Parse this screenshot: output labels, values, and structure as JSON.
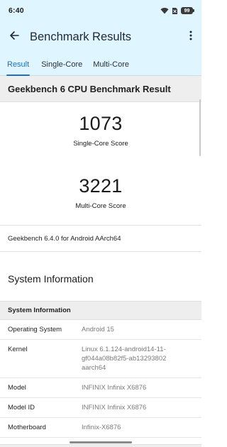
{
  "status_bar": {
    "time": "6:40",
    "battery": "99",
    "icons": [
      "wifi-icon",
      "no-sim-icon",
      "battery-icon"
    ]
  },
  "app_bar": {
    "title": "Benchmark Results",
    "back_icon": "arrow-left-icon",
    "more_icon": "more-vertical-icon"
  },
  "tabs": [
    {
      "label": "Result",
      "selected": true
    },
    {
      "label": "Single-Core",
      "selected": false
    },
    {
      "label": "Multi-Core",
      "selected": false
    }
  ],
  "result_card": {
    "header": "Geekbench 6 CPU Benchmark Result",
    "single_core": {
      "score": "1073",
      "label": "Single-Core Score"
    },
    "multi_core": {
      "score": "3221",
      "label": "Multi-Core Score"
    },
    "version": "Geekbench 6.4.0 for Android AArch64"
  },
  "system_info": {
    "section_title": "System Information",
    "table_header": "System Information",
    "rows": [
      {
        "key": "Operating System",
        "value": "Android 15"
      },
      {
        "key": "Kernel",
        "value": "Linux 6.1.124-android14-11-gf044a08b82f5-ab13293802 aarch64"
      },
      {
        "key": "Model",
        "value": "INFINIX Infinix X6876"
      },
      {
        "key": "Model ID",
        "value": "INFINIX Infinix X6876"
      },
      {
        "key": "Motherboard",
        "value": "Infinix-X6876"
      }
    ]
  },
  "colors": {
    "accent": "#1e6fc0",
    "header_bg": "#dff5ff",
    "section_bg": "#eeeeee"
  }
}
